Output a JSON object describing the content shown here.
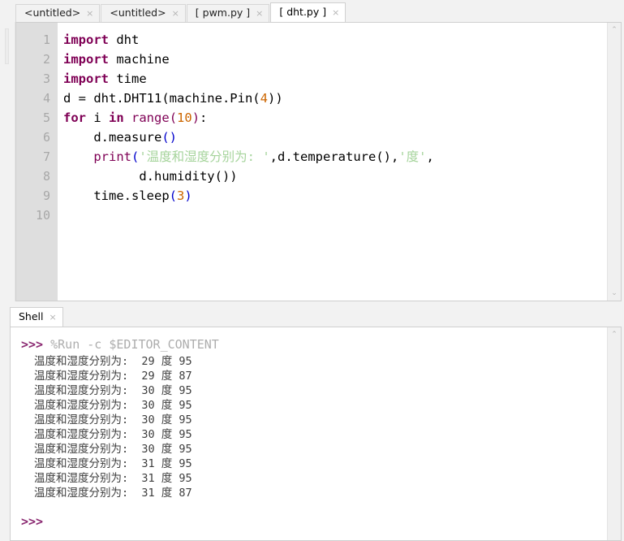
{
  "editor": {
    "tabs": [
      {
        "label": "<untitled>",
        "active": false,
        "close": "×"
      },
      {
        "label": "<untitled>",
        "active": false,
        "close": "×"
      },
      {
        "label": "[ pwm.py ]",
        "active": false,
        "close": "×"
      },
      {
        "label": "[ dht.py ]",
        "active": true,
        "close": "×"
      }
    ],
    "line_numbers": [
      "1",
      "2",
      "3",
      "4",
      "5",
      "6",
      "7",
      "8",
      "9",
      "10"
    ],
    "code_lines": [
      {
        "n": "1",
        "tokens": [
          {
            "t": "import",
            "c": "kw"
          },
          {
            "t": " dht",
            "c": "pln"
          }
        ]
      },
      {
        "n": "2",
        "tokens": [
          {
            "t": "import",
            "c": "kw"
          },
          {
            "t": " machine",
            "c": "pln"
          }
        ]
      },
      {
        "n": "3",
        "tokens": [
          {
            "t": "import",
            "c": "kw"
          },
          {
            "t": " time",
            "c": "pln"
          }
        ]
      },
      {
        "n": "4",
        "tokens": [
          {
            "t": "d = dht.DHT11(machine.Pin(",
            "c": "pln"
          },
          {
            "t": "4",
            "c": "num"
          },
          {
            "t": "))",
            "c": "pln"
          }
        ]
      },
      {
        "n": "5",
        "tokens": [
          {
            "t": "for",
            "c": "kw"
          },
          {
            "t": " i ",
            "c": "pln"
          },
          {
            "t": "in",
            "c": "kw"
          },
          {
            "t": " ",
            "c": "pln"
          },
          {
            "t": "range",
            "c": "bi"
          },
          {
            "t": "(",
            "c": "bi"
          },
          {
            "t": "10",
            "c": "num"
          },
          {
            "t": ")",
            "c": "bi"
          },
          {
            "t": ":",
            "c": "pln"
          }
        ]
      },
      {
        "n": "6",
        "tokens": [
          {
            "t": "    d.measure",
            "c": "pln"
          },
          {
            "t": "()",
            "c": "par"
          }
        ]
      },
      {
        "n": "7",
        "tokens": [
          {
            "t": "    ",
            "c": "pln"
          },
          {
            "t": "print",
            "c": "bi"
          },
          {
            "t": "(",
            "c": "par"
          },
          {
            "t": "'温度和湿度分别为: '",
            "c": "str"
          },
          {
            "t": ",d.temperature(),",
            "c": "pln"
          },
          {
            "t": "'度'",
            "c": "str"
          },
          {
            "t": ",",
            "c": "pln"
          }
        ]
      },
      {
        "n": "8",
        "tokens": [
          {
            "t": "          d.humidity())",
            "c": "pln"
          }
        ]
      },
      {
        "n": "9",
        "tokens": [
          {
            "t": "    time.sleep",
            "c": "pln"
          },
          {
            "t": "(",
            "c": "par"
          },
          {
            "t": "3",
            "c": "num"
          },
          {
            "t": ")",
            "c": "par"
          }
        ]
      },
      {
        "n": "10",
        "tokens": []
      }
    ]
  },
  "shell": {
    "tabs": [
      {
        "label": "Shell",
        "active": true,
        "close": "×"
      }
    ],
    "prompt": ">>>",
    "run_command": "%Run -c $EDITOR_CONTENT",
    "output_lines": [
      {
        "text": "温度和湿度分别为:  29 度 95",
        "temperature": 29,
        "humidity": 95
      },
      {
        "text": "温度和湿度分别为:  29 度 87",
        "temperature": 29,
        "humidity": 87
      },
      {
        "text": "温度和湿度分别为:  30 度 95",
        "temperature": 30,
        "humidity": 95
      },
      {
        "text": "温度和湿度分别为:  30 度 95",
        "temperature": 30,
        "humidity": 95
      },
      {
        "text": "温度和湿度分别为:  30 度 95",
        "temperature": 30,
        "humidity": 95
      },
      {
        "text": "温度和湿度分别为:  30 度 95",
        "temperature": 30,
        "humidity": 95
      },
      {
        "text": "温度和湿度分别为:  30 度 95",
        "temperature": 30,
        "humidity": 95
      },
      {
        "text": "温度和湿度分别为:  31 度 95",
        "temperature": 31,
        "humidity": 95
      },
      {
        "text": "温度和湿度分别为:  31 度 95",
        "temperature": 31,
        "humidity": 95
      },
      {
        "text": "温度和湿度分别为:  31 度 87",
        "temperature": 31,
        "humidity": 87
      }
    ],
    "final_prompt": ">>>"
  },
  "scrollbar": {
    "up_arrow": "⌃",
    "down_arrow": "⌄"
  },
  "colors": {
    "keyword": "#7f0055",
    "number": "#cc6600",
    "string": "#a6d49c",
    "paren": "#0000cc",
    "prompt": "#8b2a72",
    "gutter_bg": "#dedede",
    "chrome_bg": "#f2f2f2"
  }
}
